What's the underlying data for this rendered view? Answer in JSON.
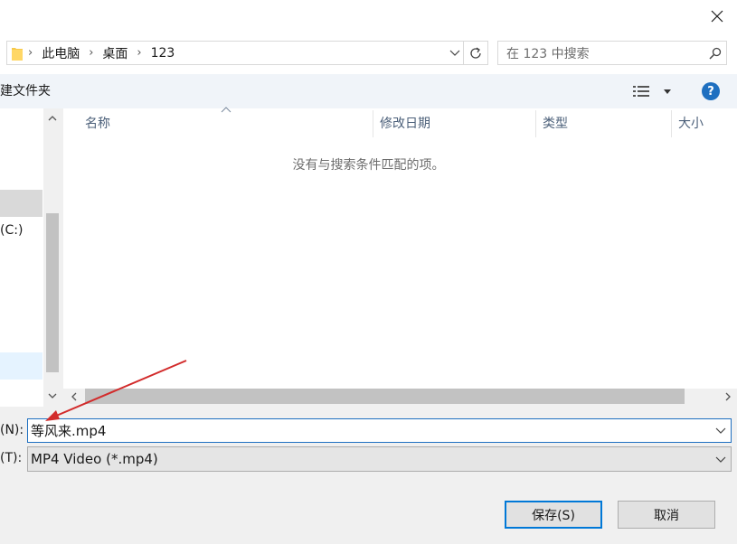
{
  "address": {
    "crumbs": [
      "此电脑",
      "桌面",
      "123"
    ]
  },
  "search": {
    "placeholder": "在 123 中搜索"
  },
  "toolbar": {
    "new_folder": "建文件夹",
    "help": "?"
  },
  "nav": {
    "drive": "(C:)"
  },
  "columns": {
    "name": "名称",
    "modified": "修改日期",
    "type": "类型",
    "size": "大小"
  },
  "empty_message": "没有与搜索条件匹配的项。",
  "filename": {
    "label": "(N):",
    "value": "等风来.mp4"
  },
  "filetype": {
    "label": "(T):",
    "value": "MP4 Video (*.mp4)"
  },
  "buttons": {
    "save": "保存(S)",
    "cancel": "取消"
  },
  "colors": {
    "accent": "#0078d7",
    "annotation_arrow": "#d22b2b",
    "help_icon": "#1e6fc0"
  }
}
